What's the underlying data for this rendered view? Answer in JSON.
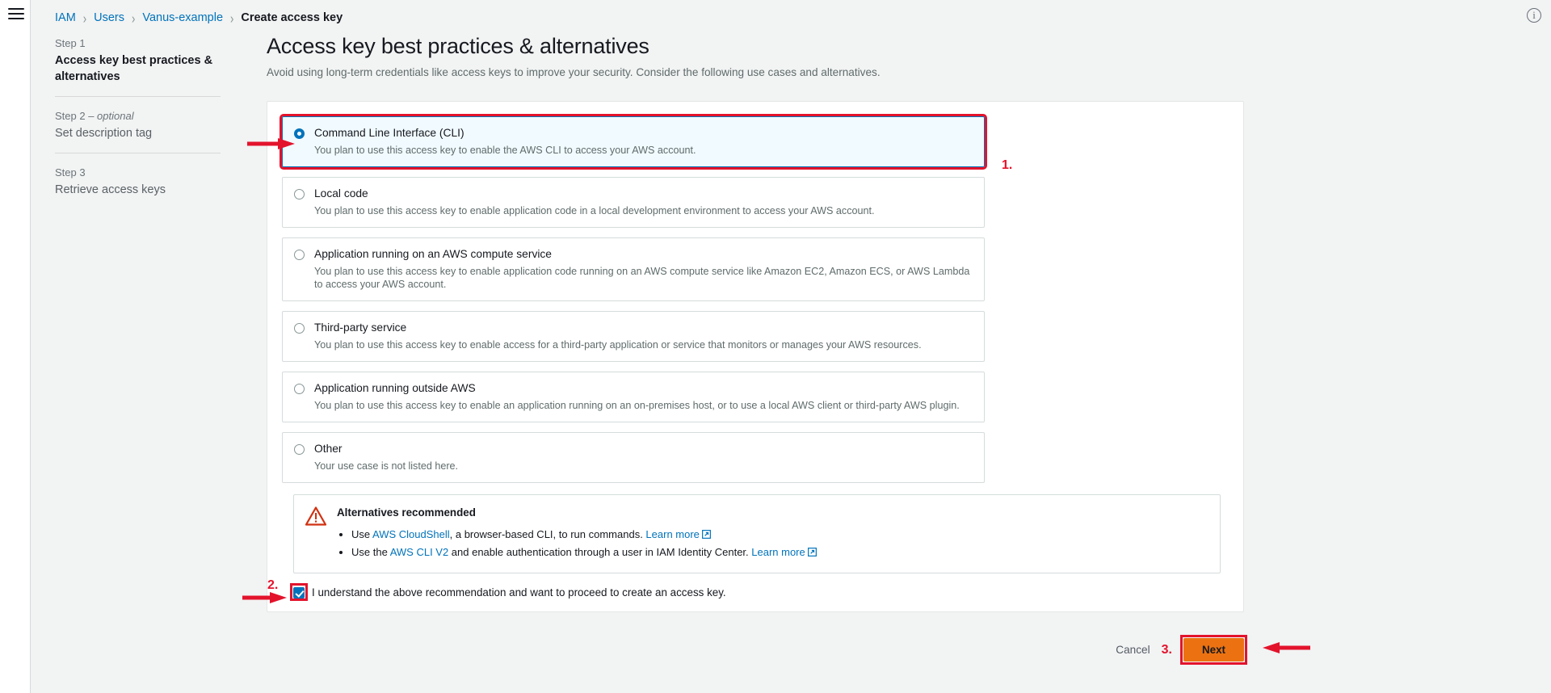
{
  "breadcrumb": {
    "items": [
      {
        "label": "IAM",
        "link": true
      },
      {
        "label": "Users",
        "link": true
      },
      {
        "label": "Vanus-example",
        "link": true
      },
      {
        "label": "Create access key",
        "link": false
      }
    ],
    "separator": "›"
  },
  "icons": {
    "hamburger": "hamburger-menu-icon",
    "info": "i",
    "external_link": "external-link-icon",
    "warning": "warning-triangle-icon"
  },
  "sidebar": {
    "steps": [
      {
        "num": "Step 1",
        "optional": "",
        "title": "Access key best practices & alternatives",
        "active": true
      },
      {
        "num": "Step 2",
        "optional": " – optional",
        "title": "Set description tag",
        "active": false
      },
      {
        "num": "Step 3",
        "optional": "",
        "title": "Retrieve access keys",
        "active": false
      }
    ]
  },
  "main": {
    "title": "Access key best practices & alternatives",
    "subtitle": "Avoid using long-term credentials like access keys to improve your security. Consider the following use cases and alternatives.",
    "options": [
      {
        "label": "Command Line Interface (CLI)",
        "desc": "You plan to use this access key to enable the AWS CLI to access your AWS account.",
        "selected": true,
        "highlighted": true
      },
      {
        "label": "Local code",
        "desc": "You plan to use this access key to enable application code in a local development environment to access your AWS account.",
        "selected": false,
        "highlighted": false
      },
      {
        "label": "Application running on an AWS compute service",
        "desc": "You plan to use this access key to enable application code running on an AWS compute service like Amazon EC2, Amazon ECS, or AWS Lambda to access your AWS account.",
        "selected": false,
        "highlighted": false
      },
      {
        "label": "Third-party service",
        "desc": "You plan to use this access key to enable access for a third-party application or service that monitors or manages your AWS resources.",
        "selected": false,
        "highlighted": false
      },
      {
        "label": "Application running outside AWS",
        "desc": "You plan to use this access key to enable an application running on an on-premises host, or to use a local AWS client or third-party AWS plugin.",
        "selected": false,
        "highlighted": false
      },
      {
        "label": "Other",
        "desc": "Your use case is not listed here.",
        "selected": false,
        "highlighted": false
      }
    ],
    "alert": {
      "title": "Alternatives recommended",
      "bullets": [
        {
          "pre": "Use ",
          "link": "AWS CloudShell",
          "post": ", a browser-based CLI, to run commands. ",
          "learn_more": "Learn more"
        },
        {
          "pre": "Use the ",
          "link": "AWS CLI V2",
          "post": " and enable authentication through a user in IAM Identity Center. ",
          "learn_more": "Learn more"
        }
      ]
    },
    "acknowledgement": {
      "label": "I understand the above recommendation and want to proceed to create an access key.",
      "checked": true
    }
  },
  "footer": {
    "cancel_label": "Cancel",
    "next_label": "Next"
  },
  "annotations": {
    "step1": "1.",
    "step2": "2.",
    "step3": "3.",
    "color": "#e3132c"
  },
  "colors": {
    "accent_link": "#0073bb",
    "next_button": "#ec7211",
    "annotation_red": "#e3132c",
    "selected_tile_bg": "#f1faff"
  }
}
